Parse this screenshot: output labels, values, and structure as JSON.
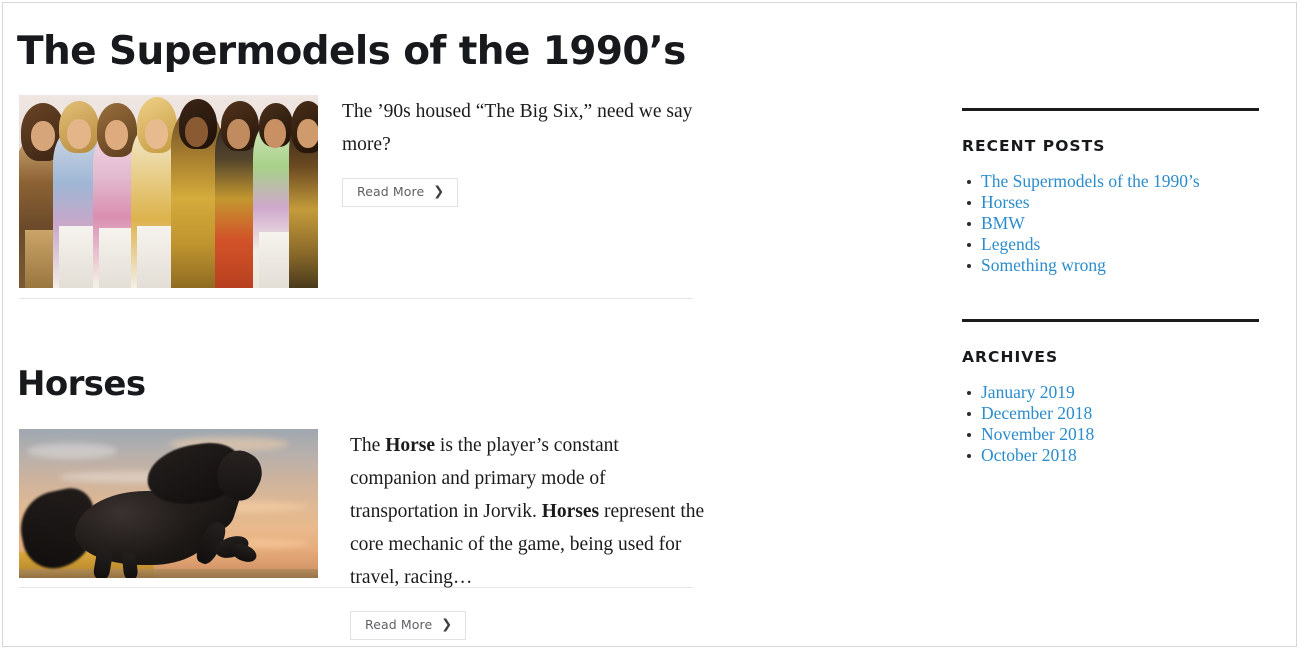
{
  "site": {
    "posts": [
      {
        "title": "The Supermodels of the 1990’s",
        "excerpt_plain": "The ’90s housed “The Big Six,” need we say more?",
        "read_more_label": "Read More",
        "read_more_chevron": "❯",
        "image_alt": "supermodels-group-photo"
      },
      {
        "title": "Horses",
        "excerpt_part_1": "The ",
        "excerpt_bold_1": "Horse",
        "excerpt_part_2": " is the player’s constant companion and primary mode of transportation in Jorvik. ",
        "excerpt_bold_2": "Horses",
        "excerpt_part_3": " represent the core mechanic of the game, being used for travel, racing…",
        "read_more_label": "Read More",
        "read_more_chevron": "❯",
        "image_alt": "black-horse-galloping-photo"
      }
    ]
  },
  "sidebar": {
    "widgets": [
      {
        "title": "Recent Posts",
        "items": [
          "The Supermodels of the 1990’s",
          "Horses",
          "BMW",
          "Legends",
          "Something wrong"
        ]
      },
      {
        "title": "Archives",
        "items": [
          "January 2019",
          "December 2018",
          "November 2018",
          "October 2018"
        ]
      }
    ]
  },
  "colors": {
    "link": "#2b8ccc",
    "text": "#1b1b1b",
    "heading": "#17191c",
    "rule": "#1b1b1b",
    "divider": "#e8e8e8",
    "button_border": "#e2e2e2",
    "button_text": "#5e6064",
    "page_border": "#d6d6d6"
  }
}
